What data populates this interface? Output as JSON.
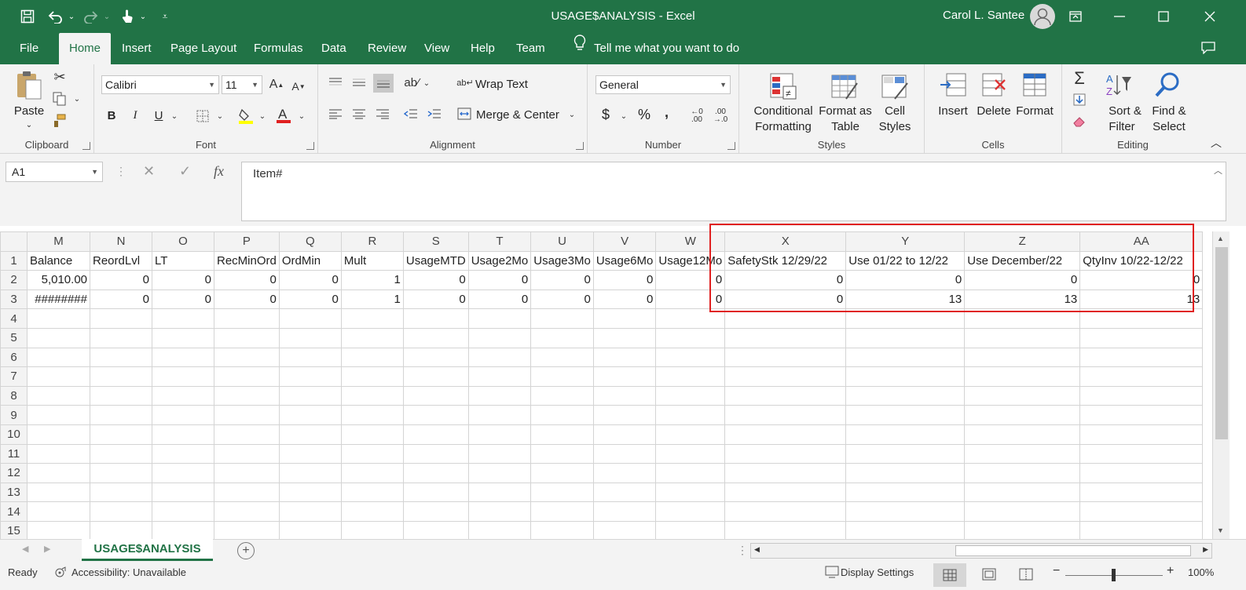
{
  "title_bar": {
    "document_title": "USAGE$ANALYSIS  -  Excel",
    "user_name": "Carol L. Santee"
  },
  "menu": {
    "tabs": [
      "File",
      "Home",
      "Insert",
      "Page Layout",
      "Formulas",
      "Data",
      "Review",
      "View",
      "Help",
      "Team"
    ],
    "active_tab": "Home",
    "tell_me": "Tell me what you want to do"
  },
  "ribbon": {
    "clipboard": {
      "label": "Clipboard",
      "paste": "Paste"
    },
    "font": {
      "label": "Font",
      "family": "Calibri",
      "size": "11",
      "bold": "B",
      "italic": "I",
      "underline": "U"
    },
    "alignment": {
      "label": "Alignment",
      "wrap_text": "Wrap Text",
      "merge_center": "Merge & Center"
    },
    "number": {
      "label": "Number",
      "format": "General",
      "currency": "$",
      "percent": "%",
      "comma": ","
    },
    "styles": {
      "label": "Styles",
      "conditional_1": "Conditional",
      "conditional_2": "Formatting",
      "format_table_1": "Format as",
      "format_table_2": "Table",
      "cell_styles_1": "Cell",
      "cell_styles_2": "Styles"
    },
    "cells": {
      "label": "Cells",
      "insert": "Insert",
      "delete": "Delete",
      "format": "Format"
    },
    "editing": {
      "label": "Editing",
      "sort_1": "Sort &",
      "sort_2": "Filter",
      "find_1": "Find &",
      "find_2": "Select"
    }
  },
  "formula_bar": {
    "name_box": "A1",
    "formula": "Item#"
  },
  "grid": {
    "columns": [
      "M",
      "N",
      "O",
      "P",
      "Q",
      "R",
      "S",
      "T",
      "U",
      "V",
      "W",
      "X",
      "Y",
      "Z",
      "AA"
    ],
    "row_numbers": [
      "1",
      "2",
      "3",
      "4",
      "5",
      "6",
      "7",
      "8",
      "9",
      "10",
      "11",
      "12",
      "13",
      "14",
      "15"
    ],
    "rows": [
      [
        "Balance",
        "ReordLvl",
        "LT",
        "RecMinOrd",
        "OrdMin",
        "Mult",
        "UsageMTD",
        "Usage2Mo",
        "Usage3Mo",
        "Usage6Mo",
        "Usage12Mo",
        "SafetyStk 12/29/22",
        "Use 01/22 to 12/22",
        "Use December/22",
        "QtyInv 10/22-12/22"
      ],
      [
        "5,010.00",
        "0",
        "0",
        "0",
        "0",
        "1",
        "0",
        "0",
        "0",
        "0",
        "0",
        "0",
        "0",
        "0",
        "0"
      ],
      [
        "########",
        "0",
        "0",
        "0",
        "0",
        "1",
        "0",
        "0",
        "0",
        "0",
        "0",
        "0",
        "13",
        "13",
        "13"
      ]
    ]
  },
  "sheet_tabs": {
    "active": "USAGE$ANALYSIS"
  },
  "status_bar": {
    "ready": "Ready",
    "accessibility": "Accessibility: Unavailable",
    "display_settings": "Display Settings",
    "zoom": "100%"
  }
}
